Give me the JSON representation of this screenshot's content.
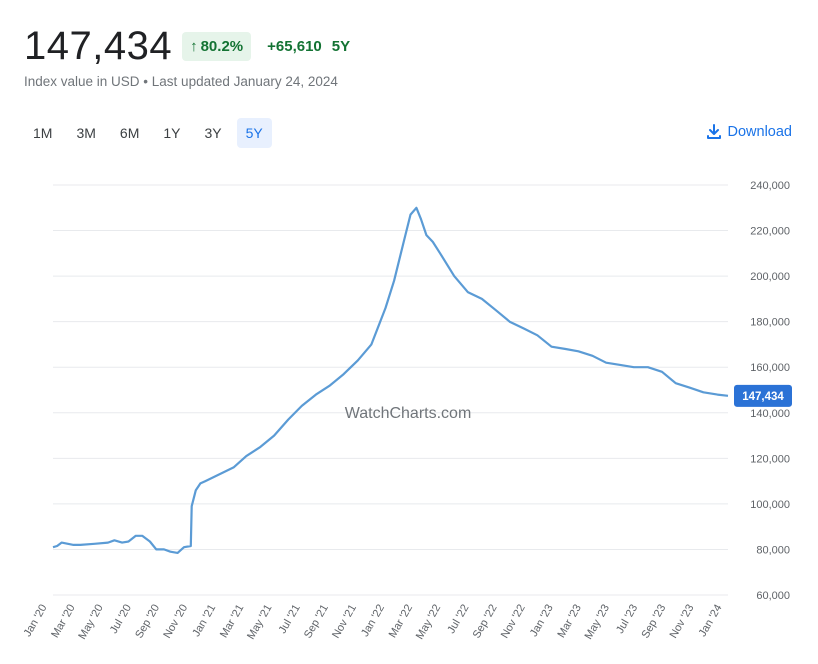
{
  "header": {
    "price": "147,434",
    "percent_change": "80.2%",
    "absolute_change": "+65,610",
    "change_period": "5Y",
    "subtitle": "Index value in USD • Last updated January 24, 2024"
  },
  "ranges": [
    "1M",
    "3M",
    "6M",
    "1Y",
    "3Y",
    "5Y"
  ],
  "active_range": "5Y",
  "download_label": "Download",
  "watermark": "WatchCharts.com",
  "colors": {
    "line": "#5b9bd5",
    "positive": "#137333",
    "positive_bg": "#e6f4ea",
    "accent": "#1a73e8",
    "last_value_bg": "#2b72d6"
  },
  "chart_data": {
    "type": "line",
    "series": [
      {
        "name": "",
        "x": [
          "2020-01-01",
          "2020-01-10",
          "2020-01-20",
          "2020-02-15",
          "2020-03-01",
          "2020-04-01",
          "2020-05-01",
          "2020-05-15",
          "2020-06-01",
          "2020-06-15",
          "2020-07-01",
          "2020-07-15",
          "2020-08-01",
          "2020-08-15",
          "2020-09-01",
          "2020-09-15",
          "2020-10-01",
          "2020-10-15",
          "2020-10-30",
          "2020-11-01",
          "2020-11-10",
          "2020-11-20",
          "2020-12-01",
          "2021-01-01",
          "2021-02-01",
          "2021-03-01",
          "2021-04-01",
          "2021-05-01",
          "2021-06-01",
          "2021-07-01",
          "2021-08-01",
          "2021-09-01",
          "2021-10-01",
          "2021-11-01",
          "2021-12-01",
          "2022-01-01",
          "2022-01-20",
          "2022-02-10",
          "2022-02-25",
          "2022-03-10",
          "2022-03-20",
          "2022-04-01",
          "2022-04-15",
          "2022-05-01",
          "2022-06-01",
          "2022-07-01",
          "2022-08-01",
          "2022-09-01",
          "2022-10-01",
          "2022-11-01",
          "2022-12-01",
          "2023-01-01",
          "2023-02-01",
          "2023-03-01",
          "2023-04-01",
          "2023-05-01",
          "2023-06-01",
          "2023-07-01",
          "2023-08-01",
          "2023-09-01",
          "2023-10-01",
          "2023-11-01",
          "2023-12-01",
          "2024-01-01",
          "2024-01-24"
        ],
        "y": [
          81000,
          81500,
          83000,
          82000,
          82000,
          82500,
          83000,
          84000,
          83000,
          83500,
          86000,
          86000,
          83500,
          80000,
          80000,
          79000,
          78500,
          81000,
          81500,
          99000,
          106000,
          109000,
          110000,
          113000,
          116000,
          121000,
          125000,
          130000,
          137000,
          143000,
          148000,
          152000,
          157000,
          163000,
          170000,
          186000,
          198000,
          215000,
          227000,
          230000,
          225000,
          218000,
          215000,
          210000,
          200000,
          193000,
          190000,
          185000,
          180000,
          177000,
          174000,
          169000,
          168000,
          167000,
          165000,
          162000,
          161000,
          160000,
          160000,
          158000,
          153000,
          151000,
          149000,
          148000,
          147434
        ]
      }
    ],
    "x_tick_labels": [
      "Jan '20",
      "Mar '20",
      "May '20",
      "Jul '20",
      "Sep '20",
      "Nov '20",
      "Jan '21",
      "Mar '21",
      "May '21",
      "Jul '21",
      "Sep '21",
      "Nov '21",
      "Jan '22",
      "Mar '22",
      "May '22",
      "Jul '22",
      "Sep '22",
      "Nov '22",
      "Jan '23",
      "Mar '23",
      "May '23",
      "Jul '23",
      "Sep '23",
      "Nov '23",
      "Jan '24"
    ],
    "y_ticks": [
      60000,
      80000,
      100000,
      120000,
      140000,
      160000,
      180000,
      200000,
      220000,
      240000
    ],
    "y_tick_labels": [
      "60,000",
      "80,000",
      "100,000",
      "120,000",
      "140,000",
      "160,000",
      "180,000",
      "200,000",
      "220,000",
      "240,000"
    ],
    "ylim": [
      60000,
      240000
    ],
    "xlim": [
      "2020-01-01",
      "2024-01-24"
    ],
    "last_value_label": "147,434",
    "grid": true,
    "y_axis_side": "right"
  }
}
